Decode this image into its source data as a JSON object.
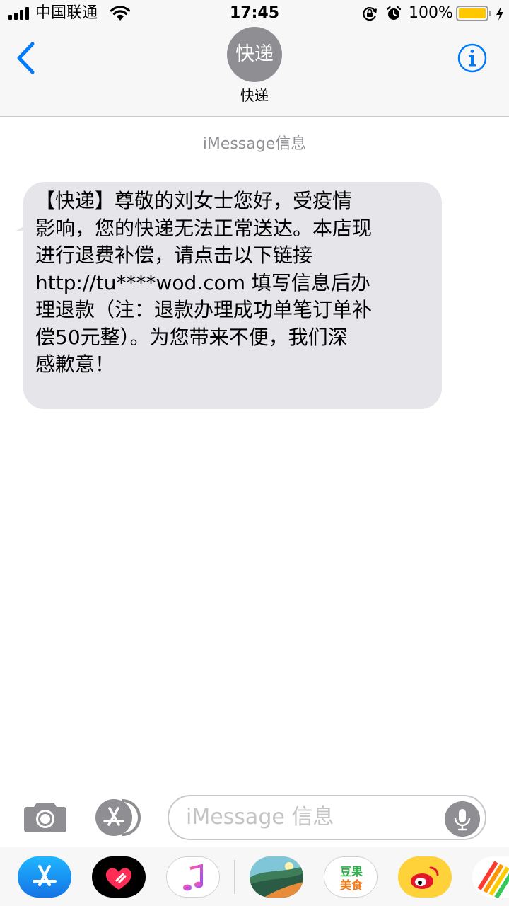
{
  "status_bar": {
    "carrier": "中国联通",
    "time": "17:45",
    "battery_percent": "100%",
    "battery_level": 1.0
  },
  "header": {
    "avatar_text": "快递",
    "contact_name": "快递"
  },
  "conversation": {
    "service_label": "iMessage信息",
    "messages": [
      {
        "direction": "incoming",
        "text": "【快递】尊敬的刘女士您好，受疫情\n影响，您的快递无法正常送达。本店现\n进行退费补偿，请点击以下链接\nhttp://tu****wod.com 填写信息后办\n理退款（注：退款办理成功单笔订单补\n偿50元整）。为您带来不便，我们深\n感歉意！"
      }
    ]
  },
  "input_bar": {
    "placeholder": "iMessage 信息"
  },
  "app_drawer": {
    "apps": [
      {
        "icon": "app-store-icon"
      },
      {
        "icon": "digital-touch-icon"
      },
      {
        "icon": "music-icon"
      },
      {
        "icon": "photos-landscape-icon"
      },
      {
        "icon": "douguo-food-icon",
        "label": "豆果美食"
      },
      {
        "icon": "weibo-icon"
      },
      {
        "icon": "colorful-app-icon"
      }
    ]
  },
  "colors": {
    "accent": "#007aff",
    "bubble": "#e5e5ea",
    "battery": "#ffc700",
    "avatar": "#8e8e93"
  }
}
